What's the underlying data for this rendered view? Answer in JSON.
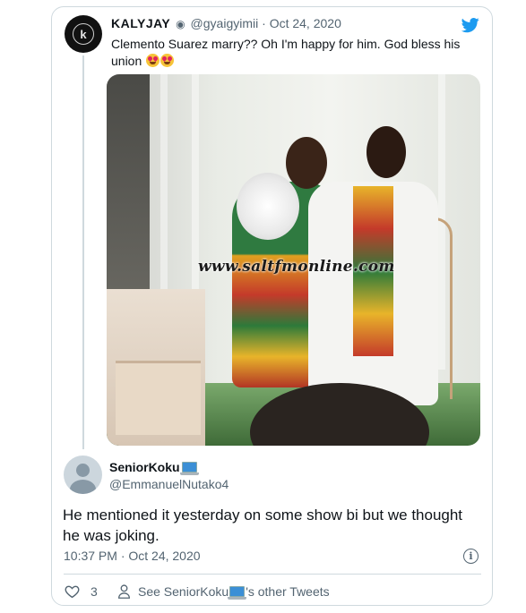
{
  "tweet": {
    "author_name": "KALYJAY",
    "author_handle": "@gyaigyimii",
    "separator": "·",
    "date": "Oct 24, 2020",
    "text": "Clemento Suarez marry?? Oh I'm happy for him. God bless his union",
    "emoji": "heart-eyes-emoji",
    "image": {
      "watermark": "www.saltfmonline.com"
    }
  },
  "reply": {
    "author_name": "SeniorKoku",
    "author_handle": "@EmmanuelNutako4",
    "text": "He mentioned it yesterday on some show bi but we thought he was joking.",
    "timestamp": "10:37 PM · Oct 24, 2020",
    "likes_count": "3",
    "see_other_prefix": "See SeniorKoku",
    "see_other_suffix": "'s other Tweets"
  },
  "colors": {
    "twitter_blue": "#1d9bf0",
    "secondary_text": "#536471",
    "border": "#cfd9de"
  }
}
